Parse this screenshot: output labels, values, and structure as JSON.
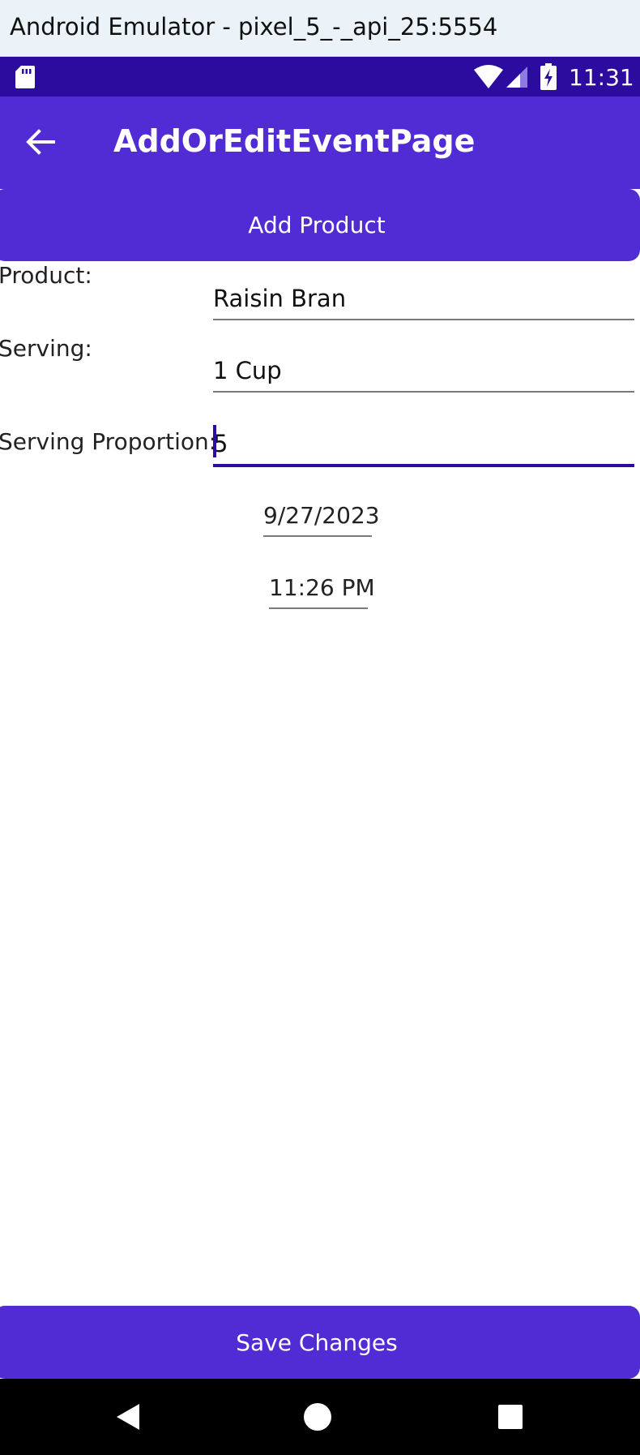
{
  "emulator": {
    "title": "Android Emulator - pixel_5_-_api_25:5554"
  },
  "status_bar": {
    "time": "11:31",
    "icons": [
      "sd-card-icon",
      "wifi-icon",
      "signal-icon",
      "battery-charging-icon"
    ]
  },
  "toolbar": {
    "title": "AddOrEditEventPage",
    "back_icon": "arrow-left-icon"
  },
  "add_product_button": {
    "label": "Add Product"
  },
  "form": {
    "product": {
      "label": "Product:",
      "value": "Raisin Bran"
    },
    "serving": {
      "label": "Serving:",
      "value": "1 Cup"
    },
    "serving_proportion": {
      "label": "Serving Proportion:",
      "value": "5"
    },
    "date": {
      "value": "9/27/2023"
    },
    "time": {
      "value": "11:26 PM"
    }
  },
  "save_button": {
    "label": "Save Changes"
  },
  "nav_bar": {
    "icons": [
      "nav-back-icon",
      "nav-home-icon",
      "nav-recents-icon"
    ]
  },
  "colors": {
    "accent": "#512bd4",
    "status_bar": "#2b0c9e",
    "nav_bar": "#000000",
    "title_bar": "#ebf3f8"
  }
}
